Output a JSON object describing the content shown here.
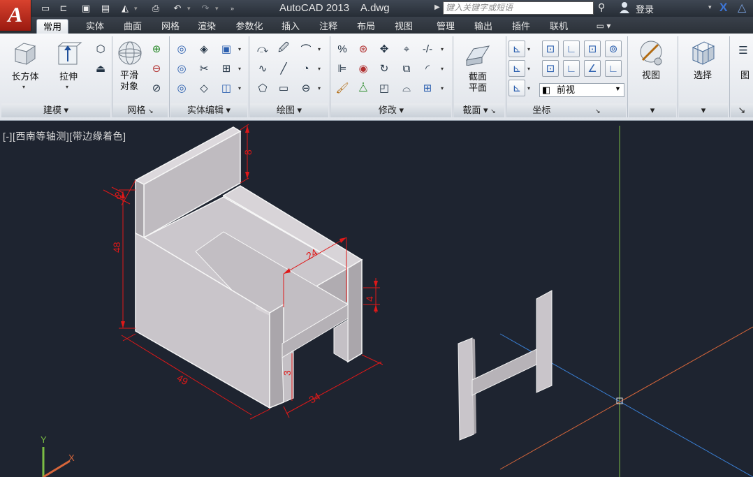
{
  "titlebar": {
    "app_logo": "A",
    "title": "AutoCAD 2013    A.dwg",
    "search_placeholder": "键入关键字或短语",
    "login": "登录",
    "icons": [
      "new-icon",
      "open-icon",
      "save-icon",
      "saveas-icon",
      "plot-icon",
      "print-icon",
      "undo-icon",
      "redo-icon",
      "binoculars-icon",
      "user-icon",
      "exchange-icon",
      "autodesk-icon"
    ]
  },
  "tabs": [
    "常用",
    "实体",
    "曲面",
    "网格",
    "渲染",
    "参数化",
    "插入",
    "注释",
    "布局",
    "视图",
    "管理",
    "输出",
    "插件",
    "联机"
  ],
  "active_tab": "常用",
  "ribbon": {
    "panels": {
      "modeling": "建模",
      "mesh": "网格",
      "solid_edit": "实体编辑",
      "draw": "绘图",
      "modify": "修改",
      "section": "截面",
      "coordinates": "坐标"
    },
    "buttons": {
      "box": "长方体",
      "extrude": "拉伸",
      "smooth_line1": "平滑",
      "smooth_line2": "对象",
      "section_line1": "截面",
      "section_line2": "平面",
      "view": "视图",
      "select": "选择",
      "partial_right": "图"
    },
    "view_select_value": "前视"
  },
  "viewport": {
    "label": "[-][西南等轴测][带边缘着色]",
    "dimensions": [
      "8",
      "8",
      "48",
      "24",
      "4",
      "49",
      "34",
      "3"
    ],
    "ucs_labels": [
      "Y",
      "X"
    ]
  },
  "colors": {
    "background": "#1e2430",
    "dimension": "#e01818",
    "model_light": "#ccc8cc",
    "model_mid": "#b7b3b8",
    "model_dark": "#a8a4a9",
    "crosshair_y": "#7bbd44",
    "crosshair_x": "#3a7fd4",
    "crosshair_z": "#d8663a"
  }
}
